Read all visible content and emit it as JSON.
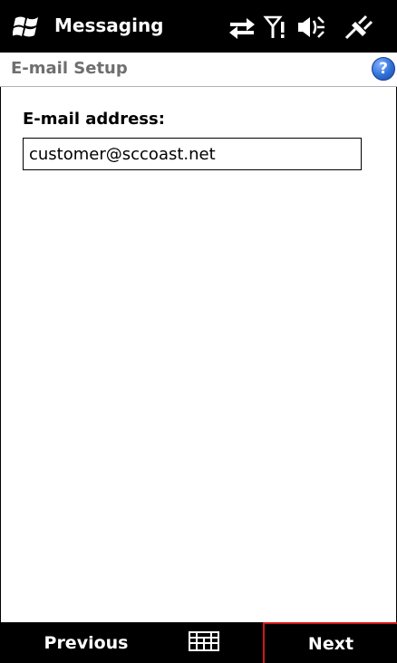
{
  "statusbar": {
    "app_title": "Messaging",
    "icons": [
      "windows-start-icon",
      "sync-icon",
      "signal-icon",
      "volume-icon",
      "power-icon"
    ]
  },
  "header": {
    "title": "E-mail Setup",
    "help_label": "?"
  },
  "form": {
    "email_label": "E-mail address:",
    "email_value": "customer@sccoast.net"
  },
  "softkeys": {
    "left_label": "Previous",
    "right_label": "Next",
    "center_icon": "keyboard-icon"
  },
  "colors": {
    "bar_background": "#000000",
    "accent_red": "#d01818",
    "help_blue": "#2f6fd6"
  }
}
